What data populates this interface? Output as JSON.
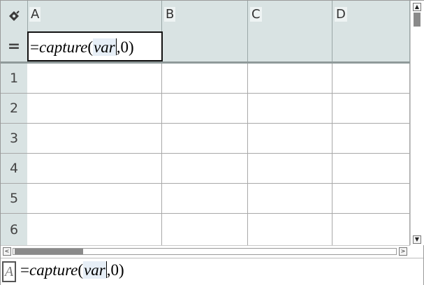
{
  "toolbar": {
    "corner_icon": "column-tag-icon"
  },
  "columns": [
    {
      "letter": "A"
    },
    {
      "letter": "B"
    },
    {
      "letter": "C"
    },
    {
      "letter": "D"
    }
  ],
  "formula_row": {
    "label": "=",
    "cell_a": {
      "prefix": "=",
      "func": "capture",
      "open_paren": "(",
      "arg": "var",
      "rest": ",0)"
    }
  },
  "rows": [
    {
      "num": "1"
    },
    {
      "num": "2"
    },
    {
      "num": "3"
    },
    {
      "num": "4"
    },
    {
      "num": "5"
    },
    {
      "num": "6"
    }
  ],
  "scrollbars": {
    "up_arrow": "▲",
    "down_arrow": "▼",
    "left_arrow": "<",
    "right_arrow": ">"
  },
  "entry_line": {
    "cell_ref": "A",
    "prefix": "=",
    "func": "capture",
    "open_paren": "(",
    "arg": "var",
    "rest": ",0)"
  },
  "colors": {
    "header_bg": "#d9e3e3",
    "grid_line": "#a8a8a8",
    "var_highlight": "#e6eef6"
  }
}
